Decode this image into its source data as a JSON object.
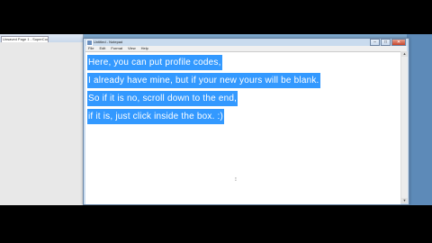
{
  "background_window": {
    "tab_label": "Unsaved Page 1 - SuperCool"
  },
  "notepad": {
    "title": "Untitled - Notepad",
    "menu": [
      "File",
      "Edit",
      "Format",
      "View",
      "Help"
    ],
    "buttons": {
      "minimize": "–",
      "maximize": "□",
      "close": "✕"
    },
    "lines": [
      "Here, you can put profile codes,",
      "I already have mine, but if your new yours will be blank.",
      "So if it is no, scroll down to the end,",
      "if it is, just click inside the box. :)"
    ],
    "selection_color": "#3399ff",
    "cursor_glyph": "⁝"
  },
  "scrollbar": {
    "up": "▲",
    "down": "▼"
  }
}
